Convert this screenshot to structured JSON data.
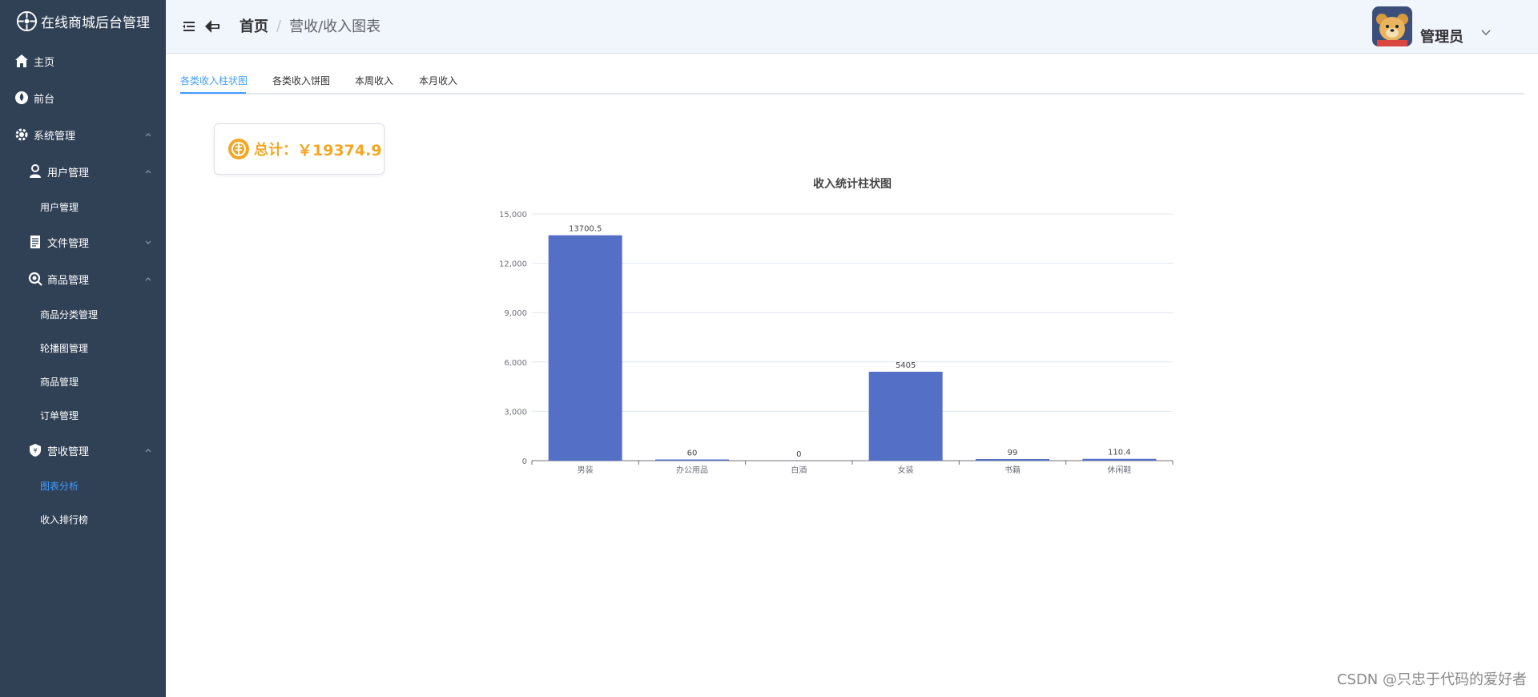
{
  "brand": {
    "title": "在线商城后台管理"
  },
  "sidebar": {
    "items": [
      {
        "label": "主页",
        "icon": "home-icon",
        "level": 0
      },
      {
        "label": "前台",
        "icon": "drop-icon",
        "level": 0
      },
      {
        "label": "系统管理",
        "icon": "gear-icon",
        "level": 0,
        "expanded": true
      },
      {
        "label": "用户管理",
        "icon": "user-icon",
        "level": 1,
        "expanded": true
      },
      {
        "label": "用户管理",
        "level": 2
      },
      {
        "label": "文件管理",
        "icon": "document-icon",
        "level": 1,
        "expanded": false
      },
      {
        "label": "商品管理",
        "icon": "magnifier-icon",
        "level": 1,
        "expanded": true
      },
      {
        "label": "商品分类管理",
        "level": 2
      },
      {
        "label": "轮播图管理",
        "level": 2
      },
      {
        "label": "商品管理",
        "level": 2
      },
      {
        "label": "订单管理",
        "level": 2
      },
      {
        "label": "营收管理",
        "icon": "shield-icon",
        "level": 1,
        "expanded": true
      },
      {
        "label": "图表分析",
        "level": 2,
        "active": true
      },
      {
        "label": "收入排行榜",
        "level": 2
      }
    ]
  },
  "header": {
    "breadcrumb_home": "首页",
    "breadcrumb_sep": "/",
    "breadcrumb_current": "营收/收入图表",
    "user_name": "管理员"
  },
  "tabs": [
    {
      "label": "各类收入柱状图",
      "active": true
    },
    {
      "label": "各类收入饼图",
      "active": false
    },
    {
      "label": "本周收入",
      "active": false
    },
    {
      "label": "本月收入",
      "active": false
    }
  ],
  "total": {
    "label": "总计：",
    "value": "￥19374.9"
  },
  "chart_data": {
    "type": "bar",
    "title": "收入统计柱状图",
    "categories": [
      "男装",
      "办公用品",
      "白酒",
      "女装",
      "书籍",
      "休闲鞋"
    ],
    "values": [
      13700.5,
      60,
      0,
      5405,
      99,
      110.4
    ],
    "value_labels": [
      "13700.5",
      "60",
      "0",
      "5405",
      "99",
      "110.4"
    ],
    "ylim": [
      0,
      15000
    ],
    "yticks": [
      0,
      3000,
      6000,
      9000,
      12000,
      15000
    ],
    "ytick_labels": [
      "0",
      "3,000",
      "6,000",
      "9,000",
      "12,000",
      "15,000"
    ],
    "bar_color": "#5470c6",
    "grid": true
  },
  "colors": {
    "sidebar_bg": "#304156",
    "accent": "#409eff",
    "total_color": "#f5a623"
  },
  "watermark": "CSDN @只忠于代码的爱好者"
}
